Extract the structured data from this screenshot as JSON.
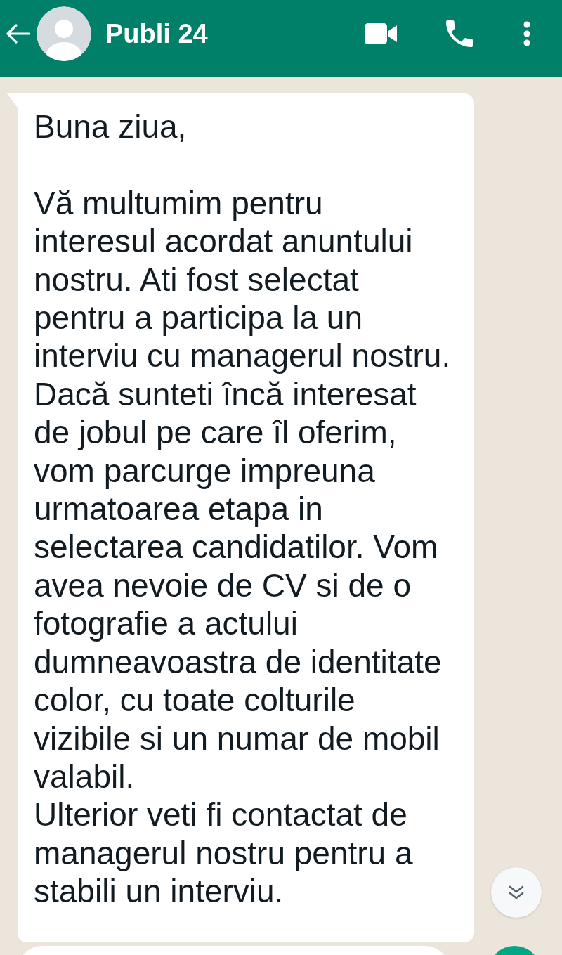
{
  "header": {
    "title": "Publi 24"
  },
  "message": {
    "text": "Buna ziua,\n\nVă multumim pentru\ninteresul acordat anuntului\nnostru. Ati fost selectat\npentru a participa la un\ninterviu cu managerul nostru.\nDacă sunteti încă interesat\nde jobul pe care îl oferim,\nvom parcurge impreuna\nurmatoarea etapa in\nselectarea candidatilor. Vom\navea nevoie de CV si de o\nfotografie a actului\ndumneavoastra de identitate\ncolor, cu toate colturile\nvizibile si un numar de mobil\nvalabil.\nUlterior veti fi contactat de\nmanagerul nostru pentru a\nstabili un interviu."
  }
}
